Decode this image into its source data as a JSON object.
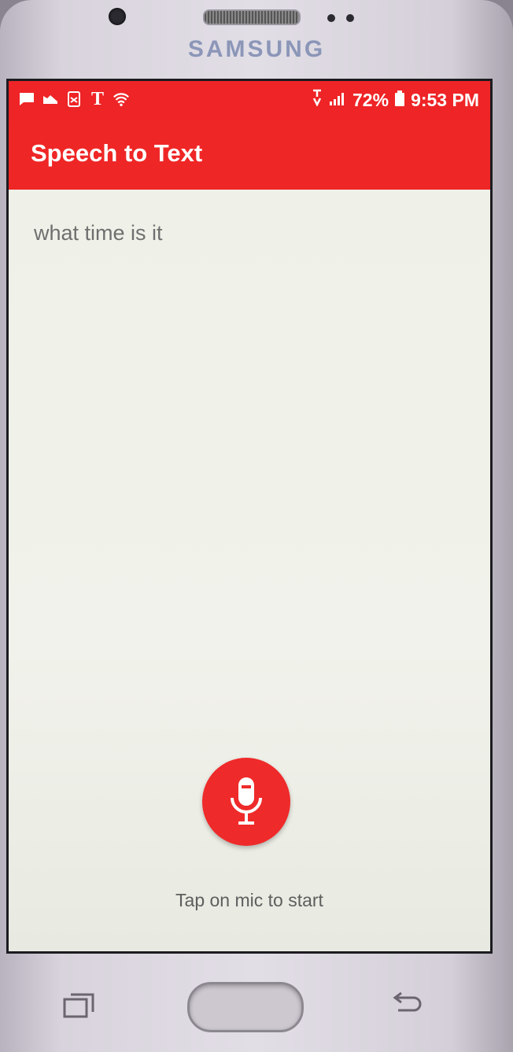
{
  "device": {
    "brand": "SAMSUNG"
  },
  "statusbar": {
    "battery": "72%",
    "time": "9:53 PM",
    "carrier_icon_letter": "T",
    "icons_left": [
      "message-icon",
      "shoe-icon",
      "sim-icon",
      "t-mobile-icon",
      "wifi-icon"
    ],
    "icons_right": [
      "volte-icon",
      "signal-icon",
      "battery-icon"
    ]
  },
  "appbar": {
    "title": "Speech to Text"
  },
  "main": {
    "transcript": "what time is it",
    "hint": "Tap on mic to start"
  },
  "colors": {
    "accent": "#ee2426",
    "background": "#eef0e6",
    "text_muted": "#6f6f6f"
  }
}
